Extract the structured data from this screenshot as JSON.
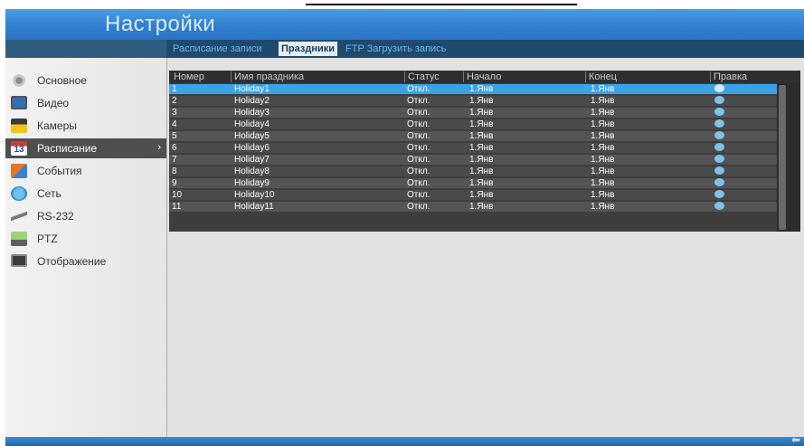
{
  "app": {
    "title": "Настройки"
  },
  "tabs": [
    {
      "label": "Расписание записи",
      "active": false
    },
    {
      "label": "Праздники",
      "active": true
    },
    {
      "label": "FTP Загрузить запись",
      "active": false
    }
  ],
  "sidebar": {
    "items": [
      {
        "label": "Основное",
        "icon": "gear-icon",
        "active": false
      },
      {
        "label": "Видео",
        "icon": "monitor-icon",
        "active": false
      },
      {
        "label": "Камеры",
        "icon": "camera-icon",
        "active": false
      },
      {
        "label": "Расписание",
        "icon": "calendar-icon",
        "active": true,
        "chevron": "›"
      },
      {
        "label": "События",
        "icon": "events-icon",
        "active": false
      },
      {
        "label": "Сеть",
        "icon": "network-icon",
        "active": false
      },
      {
        "label": "RS-232",
        "icon": "serial-port-icon",
        "active": false
      },
      {
        "label": "PTZ",
        "icon": "ptz-camera-icon",
        "active": false
      },
      {
        "label": "Отображение",
        "icon": "display-icon",
        "active": false
      }
    ]
  },
  "table": {
    "headers": [
      "Номер",
      "Имя праздника",
      "Статус",
      "Начало",
      "Конец",
      "Правка"
    ],
    "rows": [
      {
        "num": "1",
        "name": "Holiday1",
        "status": "Откл.",
        "start": "1.Янв",
        "end": "1.Янв"
      },
      {
        "num": "2",
        "name": "Holiday2",
        "status": "Откл.",
        "start": "1.Янв",
        "end": "1.Янв"
      },
      {
        "num": "3",
        "name": "Holiday3",
        "status": "Откл.",
        "start": "1.Янв",
        "end": "1.Янв"
      },
      {
        "num": "4",
        "name": "Holiday4",
        "status": "Откл.",
        "start": "1.Янв",
        "end": "1.Янв"
      },
      {
        "num": "5",
        "name": "Holiday5",
        "status": "Откл.",
        "start": "1.Янв",
        "end": "1.Янв"
      },
      {
        "num": "6",
        "name": "Holiday6",
        "status": "Откл.",
        "start": "1.Янв",
        "end": "1.Янв"
      },
      {
        "num": "7",
        "name": "Holiday7",
        "status": "Откл.",
        "start": "1.Янв",
        "end": "1.Янв"
      },
      {
        "num": "8",
        "name": "Holiday8",
        "status": "Откл.",
        "start": "1.Янв",
        "end": "1.Янв"
      },
      {
        "num": "9",
        "name": "Holiday9",
        "status": "Откл.",
        "start": "1.Янв",
        "end": "1.Янв"
      },
      {
        "num": "10",
        "name": "Holiday10",
        "status": "Откл.",
        "start": "1.Янв",
        "end": "1.Янв"
      },
      {
        "num": "11",
        "name": "Holiday11",
        "status": "Откл.",
        "start": "1.Янв",
        "end": "1.Янв"
      }
    ],
    "selected_row": 0,
    "edit_icon": "pencil-icon"
  },
  "colors": {
    "accent": "#3aa3e8",
    "titlebar": "#2f7fd0",
    "sidebar_active": "#4f4f4f"
  },
  "footer": {
    "back_icon": "back-arrow-icon",
    "back_glyph": "⬅"
  }
}
